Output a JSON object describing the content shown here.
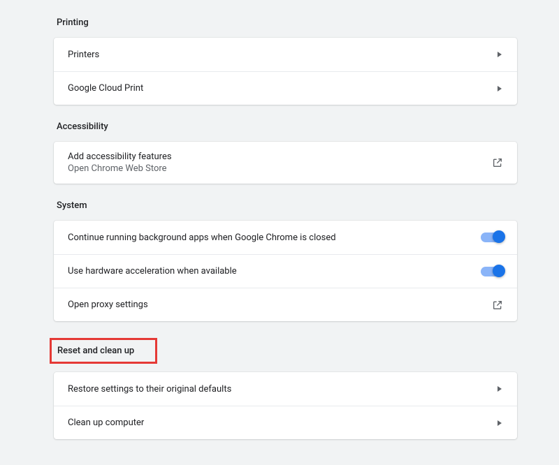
{
  "printing": {
    "title": "Printing",
    "items": [
      {
        "label": "Printers"
      },
      {
        "label": "Google Cloud Print"
      }
    ]
  },
  "accessibility": {
    "title": "Accessibility",
    "item": {
      "label": "Add accessibility features",
      "sublabel": "Open Chrome Web Store"
    }
  },
  "system": {
    "title": "System",
    "background_apps": {
      "label": "Continue running background apps when Google Chrome is closed",
      "enabled": true
    },
    "hardware_accel": {
      "label": "Use hardware acceleration when available",
      "enabled": true
    },
    "proxy": {
      "label": "Open proxy settings"
    }
  },
  "reset": {
    "title": "Reset and clean up",
    "items": [
      {
        "label": "Restore settings to their original defaults"
      },
      {
        "label": "Clean up computer"
      }
    ]
  }
}
